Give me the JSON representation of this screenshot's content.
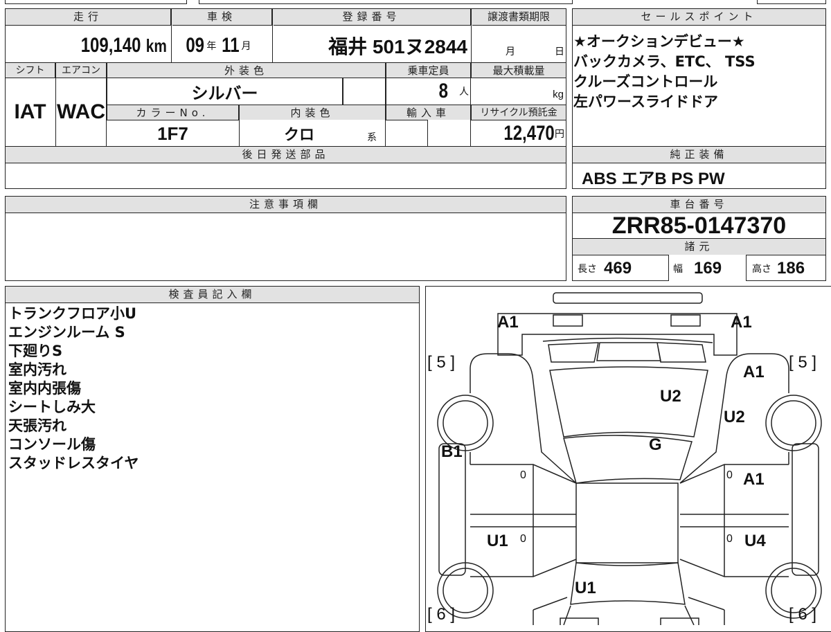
{
  "mileage": {
    "label": "走行",
    "value": "109,140",
    "unit": "km"
  },
  "shaken": {
    "label": "車検",
    "year": "09",
    "year_unit": "年",
    "month": "11",
    "month_unit": "月"
  },
  "registration": {
    "label": "登録番号",
    "value": "福井 501ヌ2844"
  },
  "transfer_deadline": {
    "label": "譲渡書類期限",
    "month": "月",
    "day": "日"
  },
  "shift": {
    "label": "シフト",
    "value": "IAT"
  },
  "aircon": {
    "label": "エアコン",
    "value": "WAC"
  },
  "exterior_color": {
    "label": "外装色",
    "value": "シルバー"
  },
  "capacity": {
    "label": "乗車定員",
    "value": "8",
    "unit": "人"
  },
  "max_load": {
    "label": "最大積載量",
    "unit": "kg"
  },
  "color_no": {
    "label": "カラーNo.",
    "value": "1F7"
  },
  "interior_color": {
    "label": "内装色",
    "value": "クロ",
    "suffix": "系"
  },
  "import": {
    "label": "輸入車"
  },
  "recycle": {
    "label": "リサイクル預託金",
    "value": "12,470",
    "unit": "円"
  },
  "later_parts": {
    "label": "後日発送部品"
  },
  "sales_points": {
    "label": "セールスポイント",
    "lines": [
      "★オークションデビュー★",
      "バックカメラ、ETC、 TSS",
      "クルーズコントロール",
      "左パワースライドドア"
    ]
  },
  "equipment": {
    "label": "純正装備",
    "value": "ABS エアB PS PW"
  },
  "notes": {
    "label": "注意事項欄"
  },
  "chassis": {
    "label": "車台番号",
    "value": "ZRR85-0147370"
  },
  "specs": {
    "label": "諸元",
    "length_label": "長さ",
    "length": "469",
    "width_label": "幅",
    "width": "169",
    "height_label": "高さ",
    "height": "186"
  },
  "inspector": {
    "label": "検査員記入欄",
    "lines": [
      "トランクフロア小U",
      "エンジンルーム S",
      "下廻りS",
      "室内汚れ",
      "室内内張傷",
      "シートしみ大",
      "天張汚れ",
      "コンソール傷",
      "スタッドレスタイヤ"
    ]
  },
  "diagram": {
    "marks": [
      "A1",
      "A1",
      "A1",
      "U2",
      "U2",
      "G",
      "B1",
      "A1",
      "U1",
      "U4",
      "U1"
    ],
    "tires": [
      "[ 5 ]",
      "[ 5 ]",
      "[ 6 ]",
      "[ 6 ]"
    ],
    "tread": [
      "0",
      "0",
      "0",
      "0"
    ]
  }
}
